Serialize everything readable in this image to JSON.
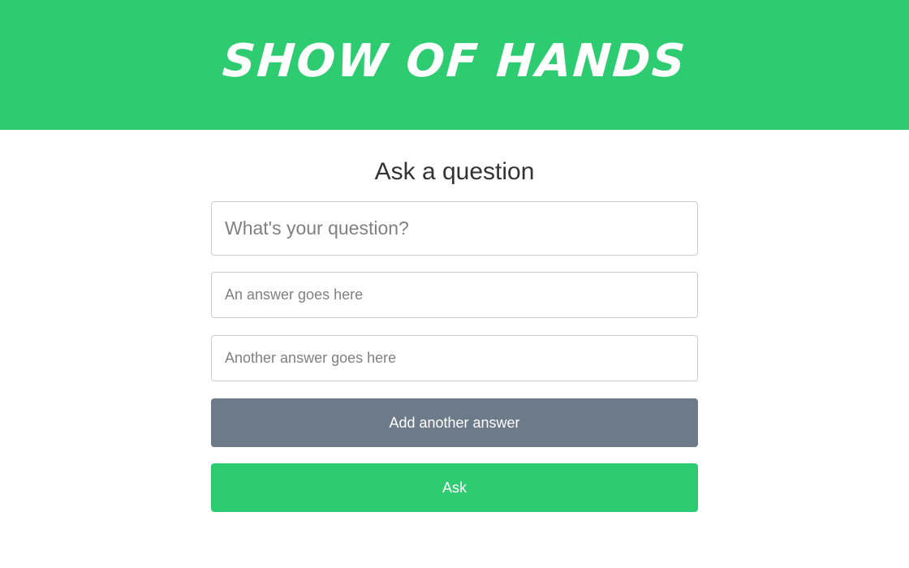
{
  "header": {
    "brand": "SHOW OF HANDS"
  },
  "form": {
    "title": "Ask a question",
    "question": {
      "value": "",
      "placeholder": "What's your question?"
    },
    "answers": [
      {
        "value": "",
        "placeholder": "An answer goes here"
      },
      {
        "value": "",
        "placeholder": "Another answer goes here"
      }
    ],
    "add_answer_label": "Add another answer",
    "ask_label": "Ask"
  },
  "colors": {
    "brand_green": "#2ecc71",
    "secondary_button": "#6c7a89",
    "text_dark": "#333333",
    "border": "#cccccc"
  }
}
